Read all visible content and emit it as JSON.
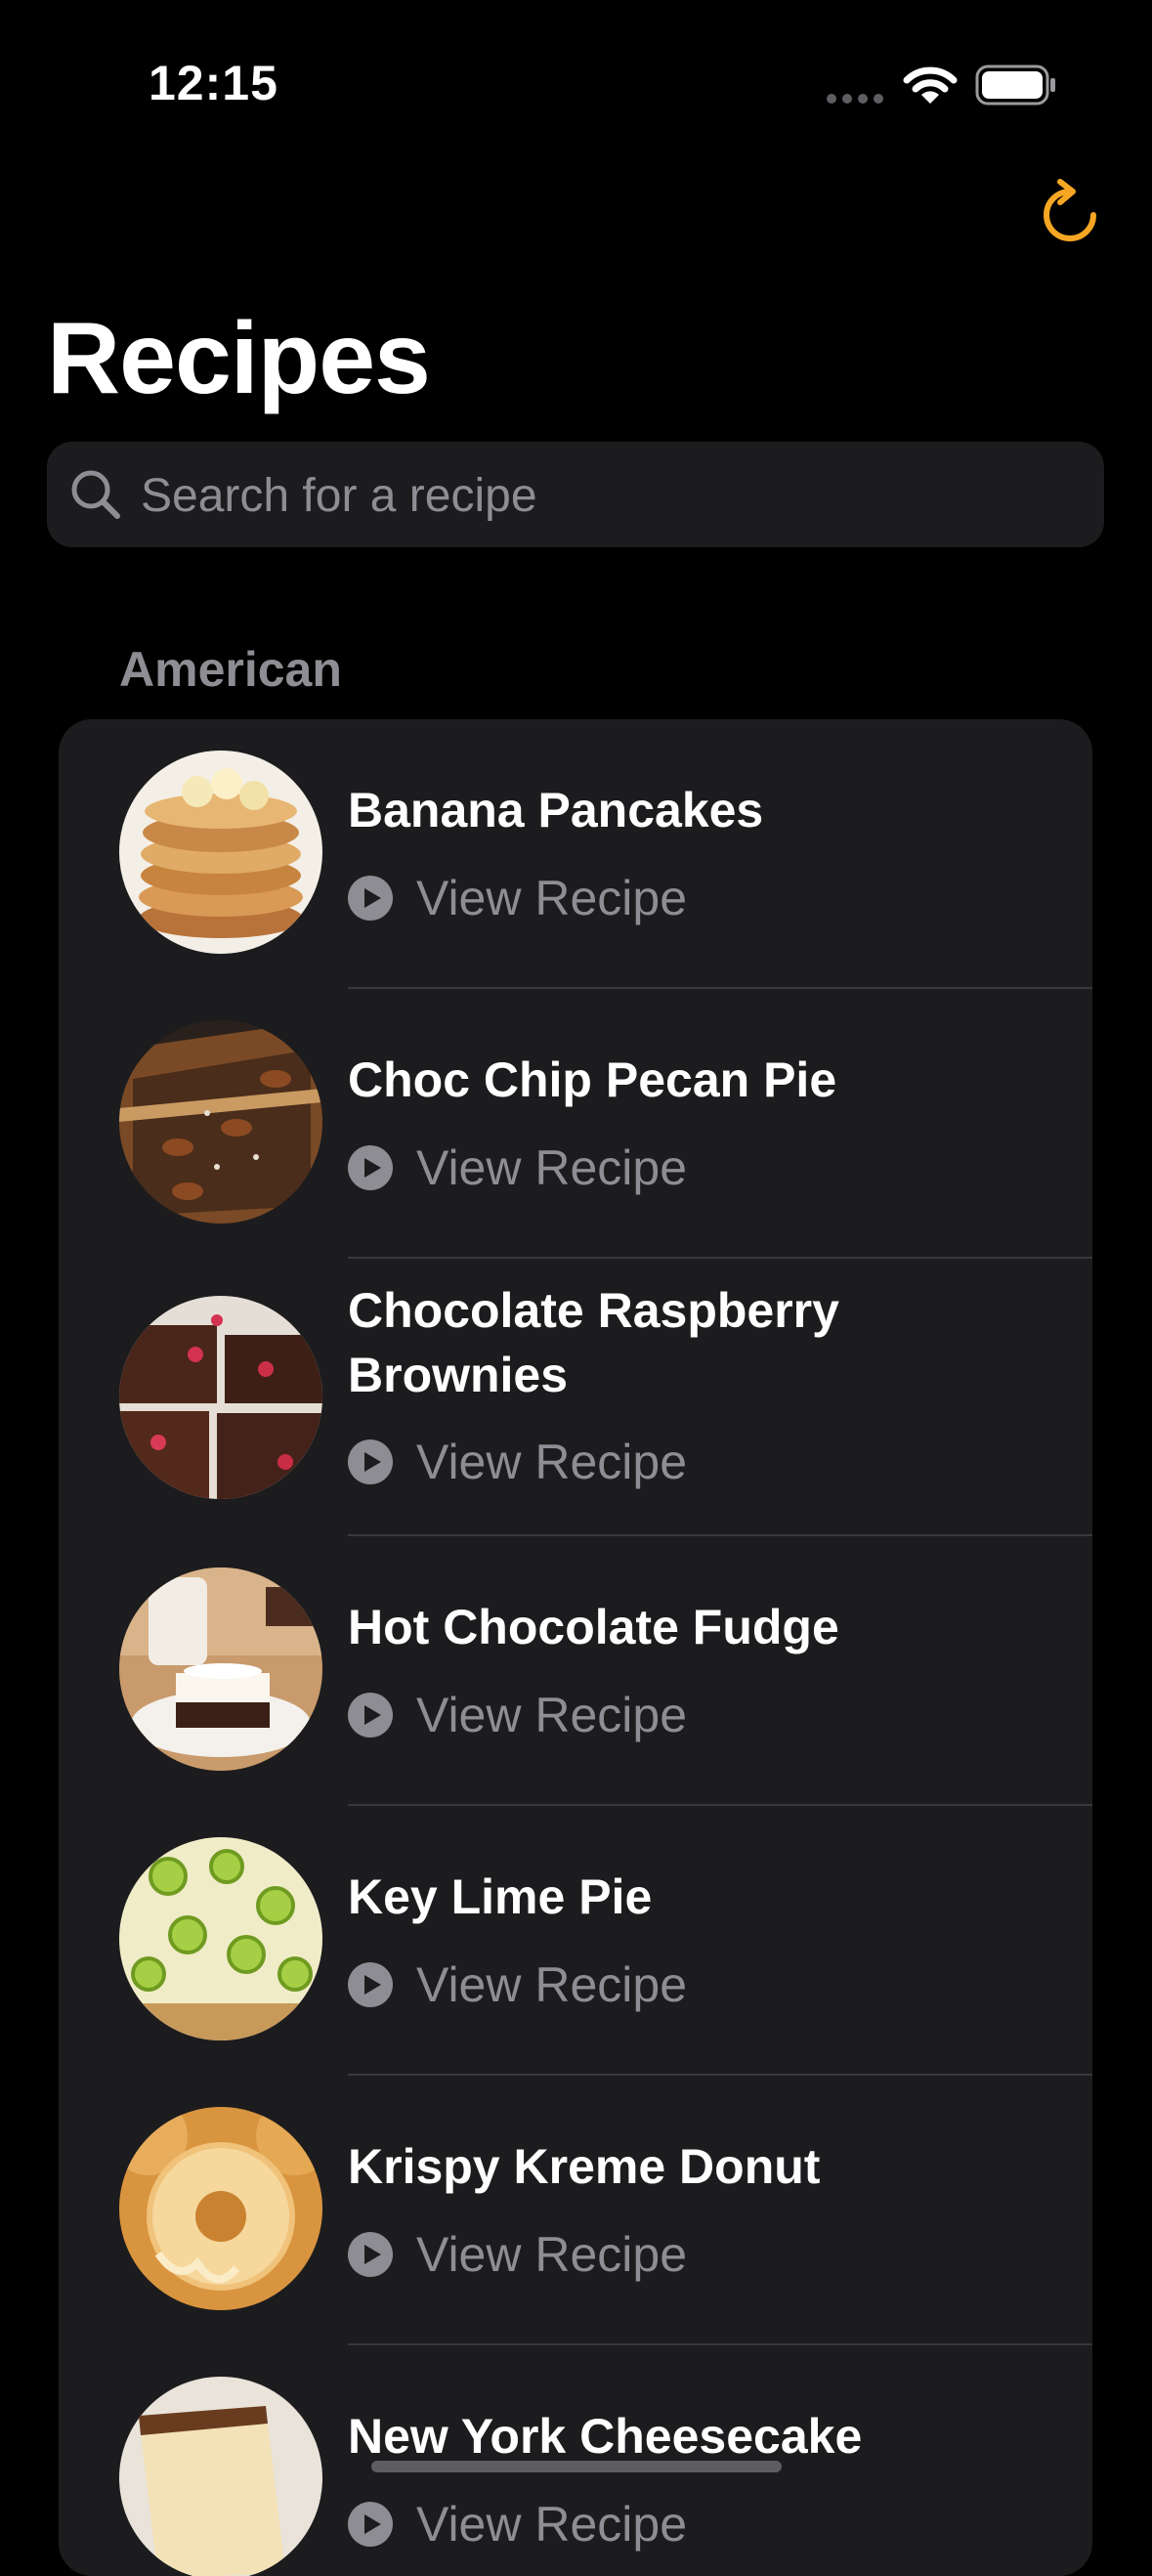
{
  "status_bar": {
    "time": "12:15"
  },
  "header": {
    "title": "Recipes"
  },
  "search": {
    "placeholder": "Search for a recipe"
  },
  "section": {
    "header": "American"
  },
  "recipes": [
    {
      "name": "Banana Pancakes",
      "action": "View Recipe"
    },
    {
      "name": "Choc Chip Pecan Pie",
      "action": "View Recipe"
    },
    {
      "name": "Chocolate Raspberry Brownies",
      "action": "View Recipe"
    },
    {
      "name": "Hot Chocolate Fudge",
      "action": "View Recipe"
    },
    {
      "name": "Key Lime Pie",
      "action": "View Recipe"
    },
    {
      "name": "Krispy Kreme Donut",
      "action": "View Recipe"
    },
    {
      "name": "New York Cheesecake",
      "action": "View Recipe"
    }
  ],
  "icons": {
    "refresh": "refresh-icon",
    "search": "search-icon",
    "play": "play-circle-icon",
    "wifi": "wifi-icon",
    "battery": "battery-icon"
  },
  "colors": {
    "background": "#000000",
    "card": "#1c1c1e",
    "accent": "#f5a623",
    "secondary_text": "#8d8d93",
    "divider": "#38383a"
  }
}
